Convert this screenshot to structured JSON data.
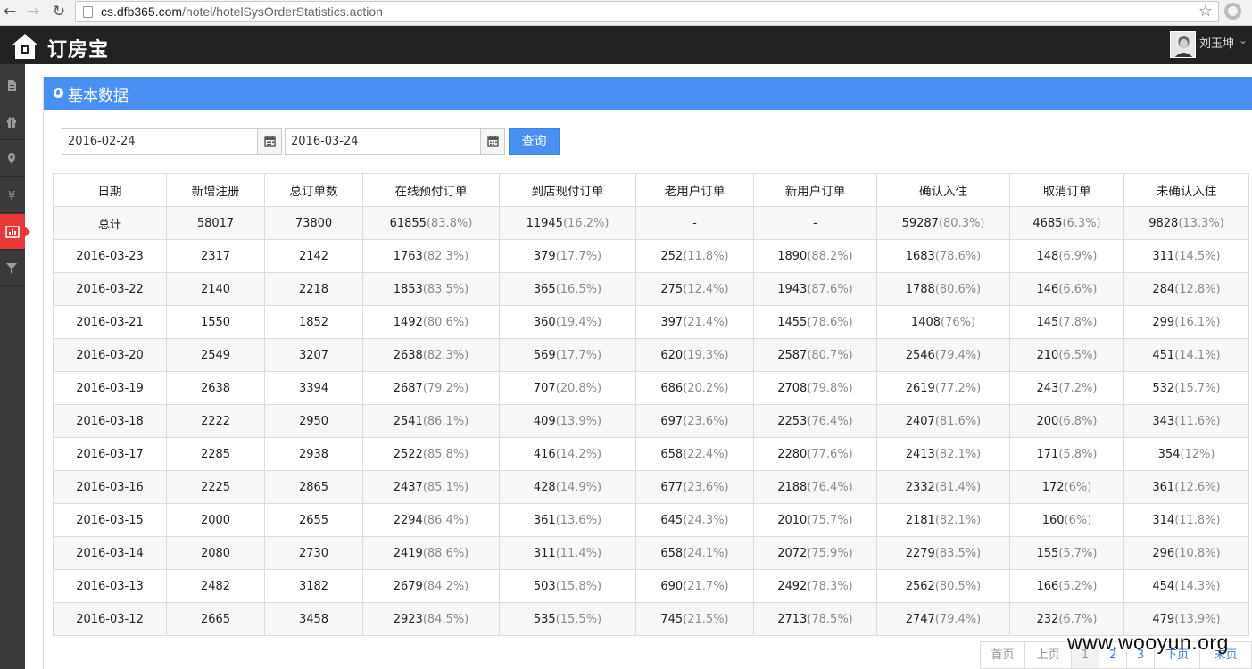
{
  "browser": {
    "url_host": "cs.dfb365.com",
    "url_path": "/hotel/hotelSysOrderStatistics.action"
  },
  "app": {
    "logo_text": "订房宝",
    "user_name": "刘玉坤"
  },
  "sidebar": {
    "items": [
      {
        "icon": "document-icon"
      },
      {
        "icon": "gift-icon"
      },
      {
        "icon": "map-marker-icon"
      },
      {
        "icon": "yen-icon"
      },
      {
        "icon": "bar-chart-icon",
        "active": true
      },
      {
        "icon": "filter-icon"
      }
    ]
  },
  "panel": {
    "title": "基本数据"
  },
  "filter": {
    "start_date": "2016-02-24",
    "end_date": "2016-03-24",
    "query_label": "查询"
  },
  "table": {
    "headers": [
      "日期",
      "新增注册",
      "总订单数",
      "在线预付订单",
      "到店现付订单",
      "老用户订单",
      "新用户订单",
      "确认入住",
      "取消订单",
      "未确认入住"
    ],
    "rows": [
      [
        [
          "总计",
          ""
        ],
        [
          "58017",
          ""
        ],
        [
          "73800",
          ""
        ],
        [
          "61855",
          "(83.8%)"
        ],
        [
          "11945",
          "(16.2%)"
        ],
        [
          "-",
          ""
        ],
        [
          "-",
          ""
        ],
        [
          "59287",
          "(80.3%)"
        ],
        [
          "4685",
          "(6.3%)"
        ],
        [
          "9828",
          "(13.3%)"
        ]
      ],
      [
        [
          "2016-03-23",
          ""
        ],
        [
          "2317",
          ""
        ],
        [
          "2142",
          ""
        ],
        [
          "1763",
          "(82.3%)"
        ],
        [
          "379",
          "(17.7%)"
        ],
        [
          "252",
          "(11.8%)"
        ],
        [
          "1890",
          "(88.2%)"
        ],
        [
          "1683",
          "(78.6%)"
        ],
        [
          "148",
          "(6.9%)"
        ],
        [
          "311",
          "(14.5%)"
        ]
      ],
      [
        [
          "2016-03-22",
          ""
        ],
        [
          "2140",
          ""
        ],
        [
          "2218",
          ""
        ],
        [
          "1853",
          "(83.5%)"
        ],
        [
          "365",
          "(16.5%)"
        ],
        [
          "275",
          "(12.4%)"
        ],
        [
          "1943",
          "(87.6%)"
        ],
        [
          "1788",
          "(80.6%)"
        ],
        [
          "146",
          "(6.6%)"
        ],
        [
          "284",
          "(12.8%)"
        ]
      ],
      [
        [
          "2016-03-21",
          ""
        ],
        [
          "1550",
          ""
        ],
        [
          "1852",
          ""
        ],
        [
          "1492",
          "(80.6%)"
        ],
        [
          "360",
          "(19.4%)"
        ],
        [
          "397",
          "(21.4%)"
        ],
        [
          "1455",
          "(78.6%)"
        ],
        [
          "1408",
          "(76%)"
        ],
        [
          "145",
          "(7.8%)"
        ],
        [
          "299",
          "(16.1%)"
        ]
      ],
      [
        [
          "2016-03-20",
          ""
        ],
        [
          "2549",
          ""
        ],
        [
          "3207",
          ""
        ],
        [
          "2638",
          "(82.3%)"
        ],
        [
          "569",
          "(17.7%)"
        ],
        [
          "620",
          "(19.3%)"
        ],
        [
          "2587",
          "(80.7%)"
        ],
        [
          "2546",
          "(79.4%)"
        ],
        [
          "210",
          "(6.5%)"
        ],
        [
          "451",
          "(14.1%)"
        ]
      ],
      [
        [
          "2016-03-19",
          ""
        ],
        [
          "2638",
          ""
        ],
        [
          "3394",
          ""
        ],
        [
          "2687",
          "(79.2%)"
        ],
        [
          "707",
          "(20.8%)"
        ],
        [
          "686",
          "(20.2%)"
        ],
        [
          "2708",
          "(79.8%)"
        ],
        [
          "2619",
          "(77.2%)"
        ],
        [
          "243",
          "(7.2%)"
        ],
        [
          "532",
          "(15.7%)"
        ]
      ],
      [
        [
          "2016-03-18",
          ""
        ],
        [
          "2222",
          ""
        ],
        [
          "2950",
          ""
        ],
        [
          "2541",
          "(86.1%)"
        ],
        [
          "409",
          "(13.9%)"
        ],
        [
          "697",
          "(23.6%)"
        ],
        [
          "2253",
          "(76.4%)"
        ],
        [
          "2407",
          "(81.6%)"
        ],
        [
          "200",
          "(6.8%)"
        ],
        [
          "343",
          "(11.6%)"
        ]
      ],
      [
        [
          "2016-03-17",
          ""
        ],
        [
          "2285",
          ""
        ],
        [
          "2938",
          ""
        ],
        [
          "2522",
          "(85.8%)"
        ],
        [
          "416",
          "(14.2%)"
        ],
        [
          "658",
          "(22.4%)"
        ],
        [
          "2280",
          "(77.6%)"
        ],
        [
          "2413",
          "(82.1%)"
        ],
        [
          "171",
          "(5.8%)"
        ],
        [
          "354",
          "(12%)"
        ]
      ],
      [
        [
          "2016-03-16",
          ""
        ],
        [
          "2225",
          ""
        ],
        [
          "2865",
          ""
        ],
        [
          "2437",
          "(85.1%)"
        ],
        [
          "428",
          "(14.9%)"
        ],
        [
          "677",
          "(23.6%)"
        ],
        [
          "2188",
          "(76.4%)"
        ],
        [
          "2332",
          "(81.4%)"
        ],
        [
          "172",
          "(6%)"
        ],
        [
          "361",
          "(12.6%)"
        ]
      ],
      [
        [
          "2016-03-15",
          ""
        ],
        [
          "2000",
          ""
        ],
        [
          "2655",
          ""
        ],
        [
          "2294",
          "(86.4%)"
        ],
        [
          "361",
          "(13.6%)"
        ],
        [
          "645",
          "(24.3%)"
        ],
        [
          "2010",
          "(75.7%)"
        ],
        [
          "2181",
          "(82.1%)"
        ],
        [
          "160",
          "(6%)"
        ],
        [
          "314",
          "(11.8%)"
        ]
      ],
      [
        [
          "2016-03-14",
          ""
        ],
        [
          "2080",
          ""
        ],
        [
          "2730",
          ""
        ],
        [
          "2419",
          "(88.6%)"
        ],
        [
          "311",
          "(11.4%)"
        ],
        [
          "658",
          "(24.1%)"
        ],
        [
          "2072",
          "(75.9%)"
        ],
        [
          "2279",
          "(83.5%)"
        ],
        [
          "155",
          "(5.7%)"
        ],
        [
          "296",
          "(10.8%)"
        ]
      ],
      [
        [
          "2016-03-13",
          ""
        ],
        [
          "2482",
          ""
        ],
        [
          "3182",
          ""
        ],
        [
          "2679",
          "(84.2%)"
        ],
        [
          "503",
          "(15.8%)"
        ],
        [
          "690",
          "(21.7%)"
        ],
        [
          "2492",
          "(78.3%)"
        ],
        [
          "2562",
          "(80.5%)"
        ],
        [
          "166",
          "(5.2%)"
        ],
        [
          "454",
          "(14.3%)"
        ]
      ],
      [
        [
          "2016-03-12",
          ""
        ],
        [
          "2665",
          ""
        ],
        [
          "3458",
          ""
        ],
        [
          "2923",
          "(84.5%)"
        ],
        [
          "535",
          "(15.5%)"
        ],
        [
          "745",
          "(21.5%)"
        ],
        [
          "2713",
          "(78.5%)"
        ],
        [
          "2747",
          "(79.4%)"
        ],
        [
          "232",
          "(6.7%)"
        ],
        [
          "479",
          "(13.9%)"
        ]
      ]
    ]
  },
  "pagination": {
    "first": "首页",
    "prev": "上页",
    "pages": [
      "1",
      "2",
      "3"
    ],
    "current": "1",
    "next": "下页",
    "last": "末页"
  },
  "watermark": "www.wooyun.org",
  "colors": {
    "accent": "#4a90f2",
    "topbar": "#222222",
    "sidebar": "#3a3a3a",
    "sidebar_active": "#e8393a"
  }
}
